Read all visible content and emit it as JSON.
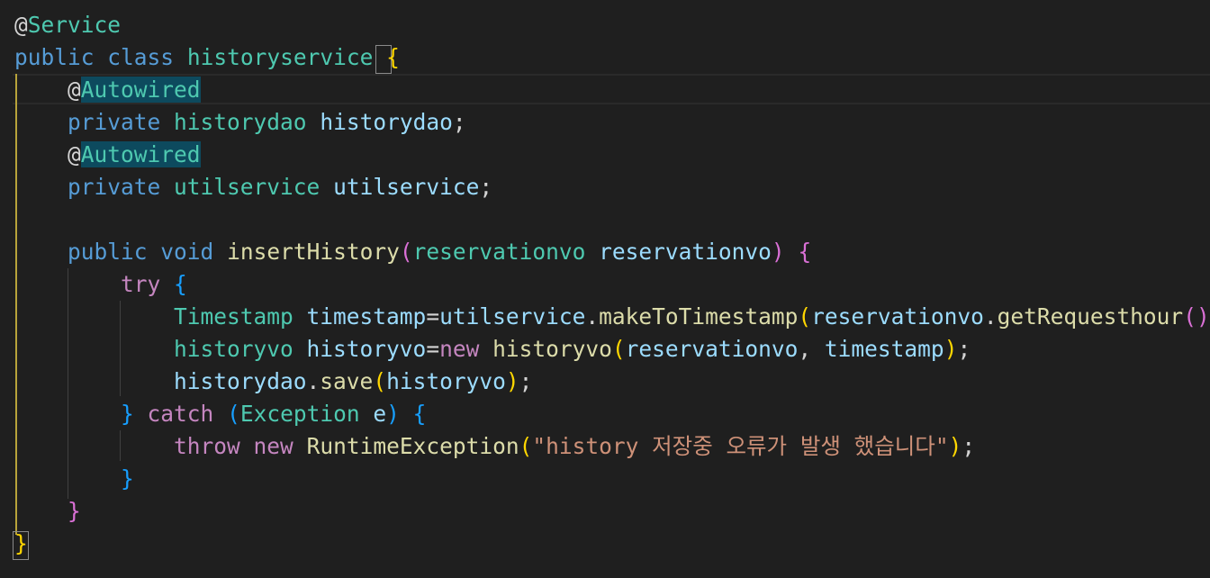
{
  "editor": {
    "language": "java",
    "theme_colors": {
      "background": "#1f1f1f",
      "keyword": "#569cd6",
      "control": "#c586c0",
      "type": "#4ec9b0",
      "variable": "#9cdcfe",
      "function": "#dcdcaa",
      "string": "#ce9178",
      "bracket_level1": "#ffd700",
      "bracket_level2": "#da70d6",
      "bracket_level3": "#179fff",
      "indent_guide_active": "#b8a33a",
      "selection_highlight": "#0d4a5e"
    },
    "lines": [
      [
        {
          "t": "@",
          "c": "c-punc"
        },
        {
          "t": "Service",
          "c": "c-type"
        }
      ],
      [
        {
          "t": "public",
          "c": "c-kw"
        },
        {
          "t": " ",
          "c": "c-punc"
        },
        {
          "t": "class",
          "c": "c-kw"
        },
        {
          "t": " ",
          "c": "c-punc"
        },
        {
          "t": "historyservice",
          "c": "c-type"
        },
        {
          "t": " ",
          "c": "c-punc"
        },
        {
          "t": "{",
          "c": "c-br1",
          "box": true
        }
      ],
      [
        {
          "t": "    ",
          "c": "c-punc"
        },
        {
          "t": "@",
          "c": "c-punc"
        },
        {
          "t": "Autowired",
          "c": "c-type hl-word"
        }
      ],
      [
        {
          "t": "    ",
          "c": "c-punc"
        },
        {
          "t": "private",
          "c": "c-kw"
        },
        {
          "t": " ",
          "c": "c-punc"
        },
        {
          "t": "historydao",
          "c": "c-type"
        },
        {
          "t": " ",
          "c": "c-punc"
        },
        {
          "t": "historydao",
          "c": "c-var"
        },
        {
          "t": ";",
          "c": "c-punc"
        }
      ],
      [
        {
          "t": "    ",
          "c": "c-punc"
        },
        {
          "t": "@",
          "c": "c-punc"
        },
        {
          "t": "Autowired",
          "c": "c-type hl-word"
        }
      ],
      [
        {
          "t": "    ",
          "c": "c-punc"
        },
        {
          "t": "private",
          "c": "c-kw"
        },
        {
          "t": " ",
          "c": "c-punc"
        },
        {
          "t": "utilservice",
          "c": "c-type"
        },
        {
          "t": " ",
          "c": "c-punc"
        },
        {
          "t": "utilservice",
          "c": "c-var"
        },
        {
          "t": ";",
          "c": "c-punc"
        }
      ],
      [],
      [
        {
          "t": "    ",
          "c": "c-punc"
        },
        {
          "t": "public",
          "c": "c-kw"
        },
        {
          "t": " ",
          "c": "c-punc"
        },
        {
          "t": "void",
          "c": "c-kw"
        },
        {
          "t": " ",
          "c": "c-punc"
        },
        {
          "t": "insertHistory",
          "c": "c-fn"
        },
        {
          "t": "(",
          "c": "c-br2"
        },
        {
          "t": "reservationvo",
          "c": "c-type"
        },
        {
          "t": " ",
          "c": "c-punc"
        },
        {
          "t": "reservationvo",
          "c": "c-var"
        },
        {
          "t": ")",
          "c": "c-br2"
        },
        {
          "t": " ",
          "c": "c-punc"
        },
        {
          "t": "{",
          "c": "c-br2"
        }
      ],
      [
        {
          "t": "        ",
          "c": "c-punc"
        },
        {
          "t": "try",
          "c": "c-ctrl"
        },
        {
          "t": " ",
          "c": "c-punc"
        },
        {
          "t": "{",
          "c": "c-br3"
        }
      ],
      [
        {
          "t": "            ",
          "c": "c-punc"
        },
        {
          "t": "Timestamp",
          "c": "c-type"
        },
        {
          "t": " ",
          "c": "c-punc"
        },
        {
          "t": "timestamp",
          "c": "c-var"
        },
        {
          "t": "=",
          "c": "c-punc"
        },
        {
          "t": "utilservice",
          "c": "c-var"
        },
        {
          "t": ".",
          "c": "c-punc"
        },
        {
          "t": "makeToTimestamp",
          "c": "c-fn"
        },
        {
          "t": "(",
          "c": "c-br1"
        },
        {
          "t": "reservationvo",
          "c": "c-var"
        },
        {
          "t": ".",
          "c": "c-punc"
        },
        {
          "t": "getRequesthour",
          "c": "c-fn"
        },
        {
          "t": "()",
          "c": "c-br2"
        },
        {
          "t": ")",
          "c": "c-br1"
        },
        {
          "t": ";",
          "c": "c-punc"
        }
      ],
      [
        {
          "t": "            ",
          "c": "c-punc"
        },
        {
          "t": "historyvo",
          "c": "c-type"
        },
        {
          "t": " ",
          "c": "c-punc"
        },
        {
          "t": "historyvo",
          "c": "c-var"
        },
        {
          "t": "=",
          "c": "c-punc"
        },
        {
          "t": "new",
          "c": "c-ctrl"
        },
        {
          "t": " ",
          "c": "c-punc"
        },
        {
          "t": "historyvo",
          "c": "c-fn"
        },
        {
          "t": "(",
          "c": "c-br1"
        },
        {
          "t": "reservationvo",
          "c": "c-var"
        },
        {
          "t": ", ",
          "c": "c-punc"
        },
        {
          "t": "timestamp",
          "c": "c-var"
        },
        {
          "t": ")",
          "c": "c-br1"
        },
        {
          "t": ";",
          "c": "c-punc"
        }
      ],
      [
        {
          "t": "            ",
          "c": "c-punc"
        },
        {
          "t": "historydao",
          "c": "c-var"
        },
        {
          "t": ".",
          "c": "c-punc"
        },
        {
          "t": "save",
          "c": "c-fn"
        },
        {
          "t": "(",
          "c": "c-br1"
        },
        {
          "t": "historyvo",
          "c": "c-var"
        },
        {
          "t": ")",
          "c": "c-br1"
        },
        {
          "t": ";",
          "c": "c-punc"
        }
      ],
      [
        {
          "t": "        ",
          "c": "c-punc"
        },
        {
          "t": "}",
          "c": "c-br3"
        },
        {
          "t": " ",
          "c": "c-punc"
        },
        {
          "t": "catch",
          "c": "c-ctrl"
        },
        {
          "t": " ",
          "c": "c-punc"
        },
        {
          "t": "(",
          "c": "c-br3"
        },
        {
          "t": "Exception",
          "c": "c-type"
        },
        {
          "t": " ",
          "c": "c-punc"
        },
        {
          "t": "e",
          "c": "c-var"
        },
        {
          "t": ")",
          "c": "c-br3"
        },
        {
          "t": " ",
          "c": "c-punc"
        },
        {
          "t": "{",
          "c": "c-br3"
        }
      ],
      [
        {
          "t": "            ",
          "c": "c-punc"
        },
        {
          "t": "throw",
          "c": "c-ctrl"
        },
        {
          "t": " ",
          "c": "c-punc"
        },
        {
          "t": "new",
          "c": "c-ctrl"
        },
        {
          "t": " ",
          "c": "c-punc"
        },
        {
          "t": "RuntimeException",
          "c": "c-fn"
        },
        {
          "t": "(",
          "c": "c-br1"
        },
        {
          "t": "\"history 저장중 오류가 발생 했습니다\"",
          "c": "c-str"
        },
        {
          "t": ")",
          "c": "c-br1"
        },
        {
          "t": ";",
          "c": "c-punc"
        }
      ],
      [
        {
          "t": "        ",
          "c": "c-punc"
        },
        {
          "t": "}",
          "c": "c-br3"
        }
      ],
      [
        {
          "t": "    ",
          "c": "c-punc"
        },
        {
          "t": "}",
          "c": "c-br2"
        }
      ],
      [
        {
          "t": "}",
          "c": "c-br1",
          "box": true
        }
      ]
    ]
  }
}
